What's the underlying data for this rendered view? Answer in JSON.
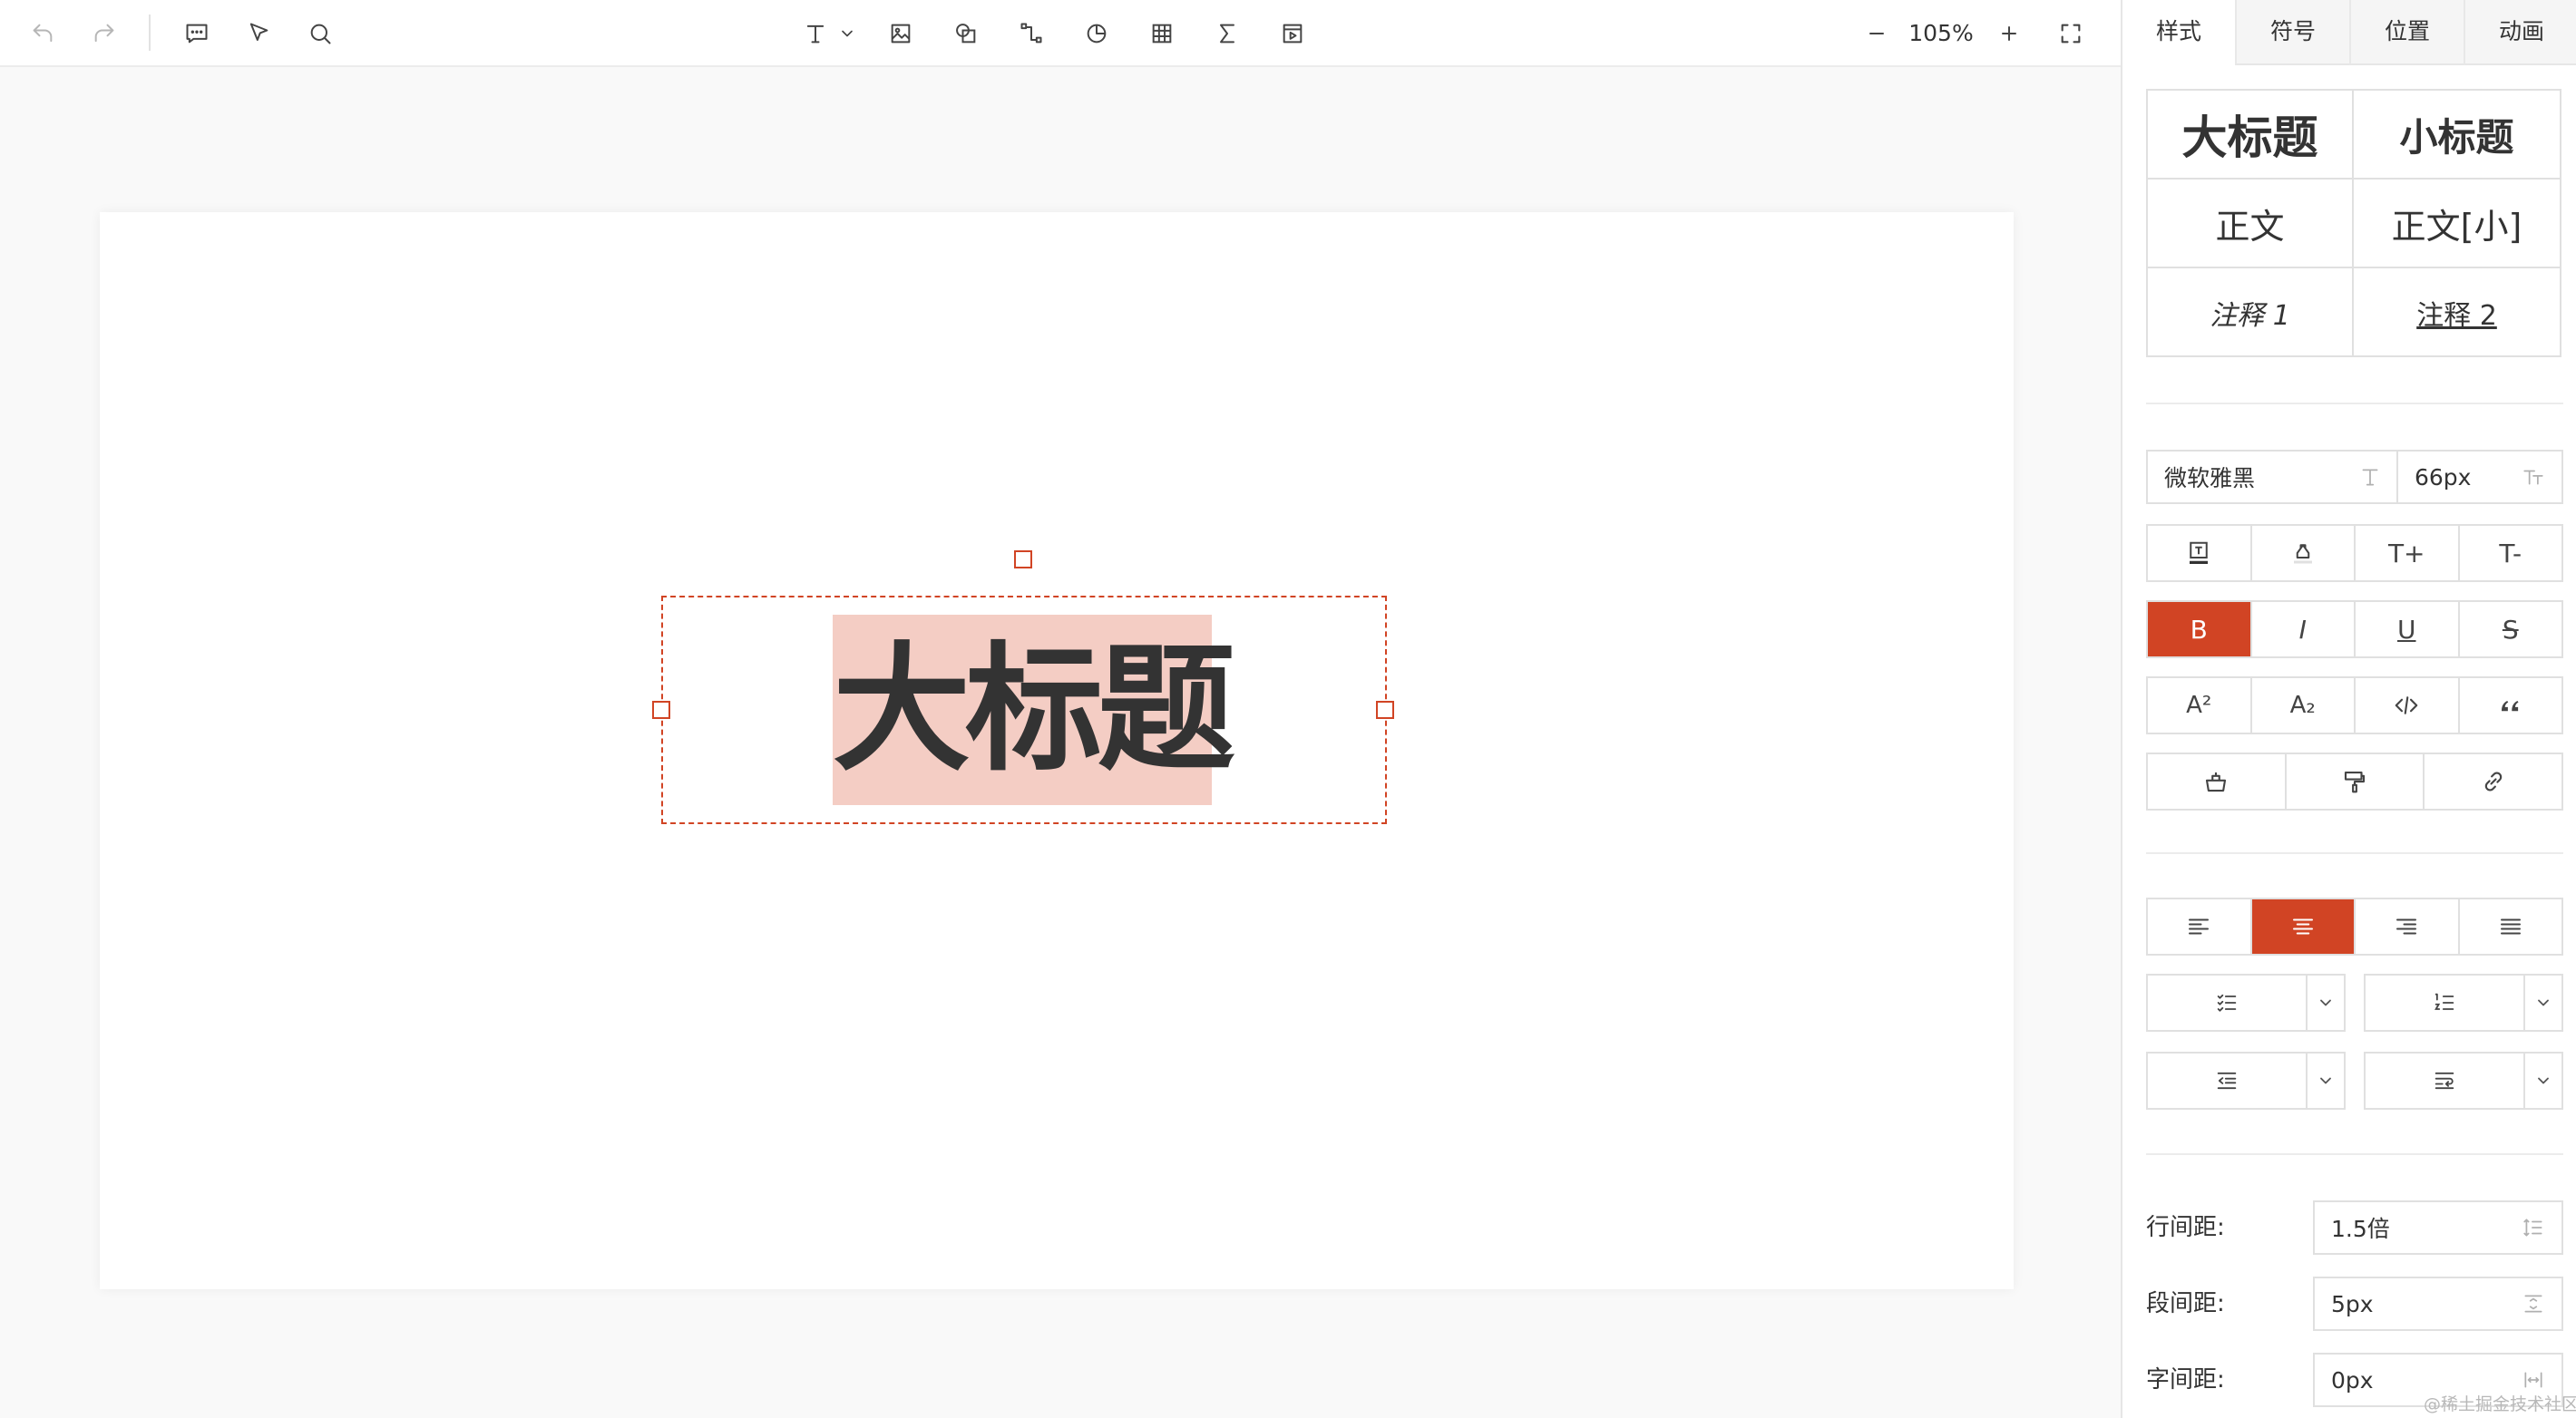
{
  "toolbar": {
    "zoom": "105%"
  },
  "slide": {
    "title_text": "大标题"
  },
  "panel": {
    "tabs": [
      "样式",
      "符号",
      "位置",
      "动画"
    ],
    "presets": {
      "big_title": "大标题",
      "small_title": "小标题",
      "body": "正文",
      "body_small": "正文[小]",
      "note1": "注释 1",
      "note2": "注释 2"
    },
    "font_family": "微软雅黑",
    "font_size": "66px",
    "format_row": {
      "font_bigger": "T+",
      "font_smaller": "T-",
      "bold": "B",
      "italic": "I",
      "underline": "U",
      "strike": "S",
      "superscript": "A²",
      "subscript": "A₂"
    },
    "line_height_label": "行间距:",
    "line_height_value": "1.5倍",
    "paragraph_space_label": "段间距:",
    "paragraph_space_value": "5px",
    "letter_space_label": "字间距:",
    "letter_space_value": "0px"
  },
  "colors": {
    "accent": "#d14424",
    "selection": "#f4cdc4"
  },
  "watermark": "@稀土掘金技术社区"
}
